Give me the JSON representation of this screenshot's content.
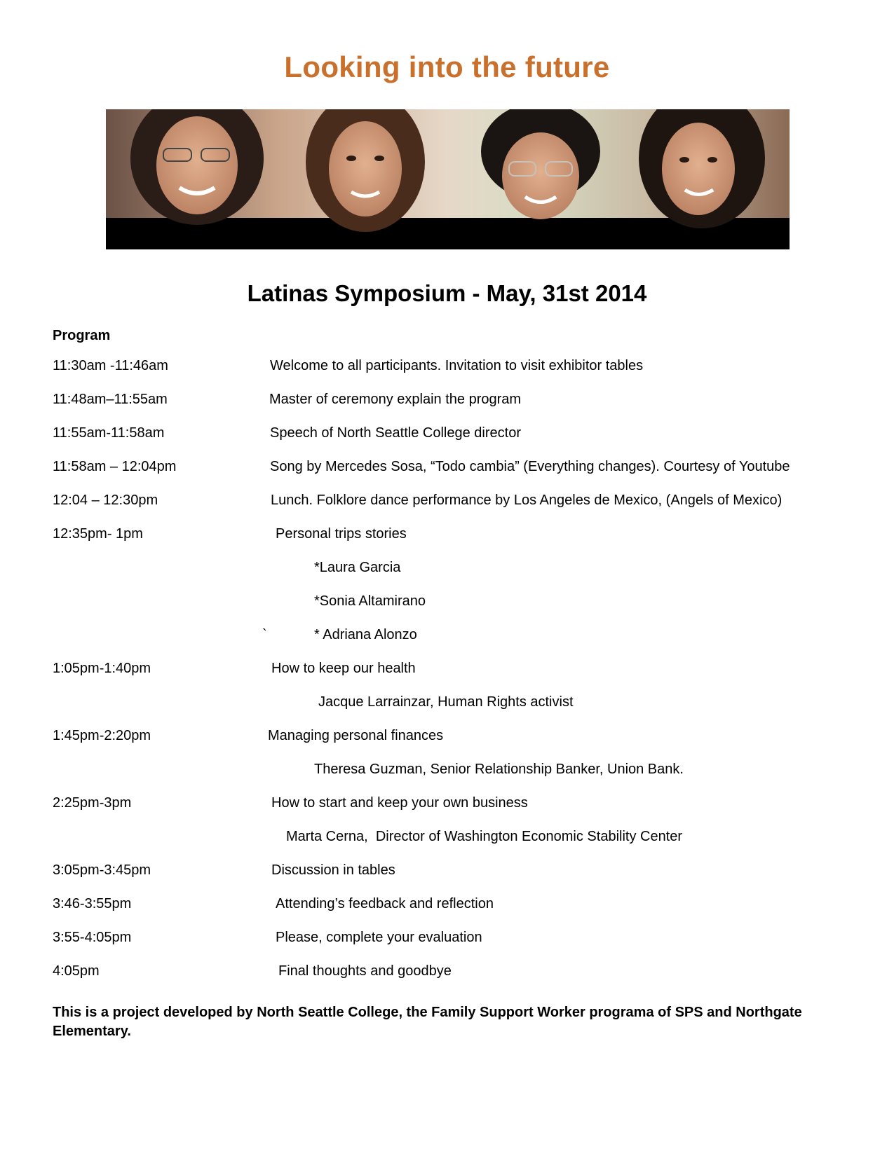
{
  "title": "Looking into the future",
  "subtitle": "Latinas Symposium - May, 31st 2014",
  "program_label": "Program",
  "schedule": [
    {
      "time": "11:30am -11:46am",
      "text": "Welcome to all participants. Invitation to visit exhibitor tables"
    },
    {
      "time": "11:48am–11:55am",
      "text": "Master of ceremony explain the program"
    },
    {
      "time": "11:55am-11:58am",
      "text": "Speech of North Seattle College director"
    },
    {
      "time": "11:58am – 12:04pm",
      "text": "Song by Mercedes Sosa, “Todo cambia” (Everything changes). Courtesy of Youtube"
    },
    {
      "time": "12:04 – 12:30pm",
      "text": "Lunch. Folklore dance performance by Los Angeles de Mexico, (Angels of Mexico)"
    },
    {
      "time": "12:35pm- 1pm",
      "text": "Personal trips stories"
    },
    {
      "time": "",
      "text": "*Laura Garcia"
    },
    {
      "time": "",
      "text": "*Sonia Altamirano"
    },
    {
      "time": "",
      "text": "* Adriana Alonzo",
      "mark": "`"
    },
    {
      "time": "1:05pm-1:40pm",
      "text": "How to keep our health"
    },
    {
      "time": "",
      "text": "Jacque Larrainzar, Human Rights activist"
    },
    {
      "time": "1:45pm-2:20pm",
      "text": "Managing personal finances"
    },
    {
      "time": "",
      "text": "Theresa Guzman, Senior Relationship Banker, Union Bank."
    },
    {
      "time": "2:25pm-3pm",
      "text": "How to start and keep your own business"
    },
    {
      "time": "",
      "text": "Marta Cerna,  Director of Washington Economic Stability Center"
    },
    {
      "time": "3:05pm-3:45pm",
      "text": "Discussion in tables"
    },
    {
      "time": "3:46-3:55pm",
      "text": "Attending’s feedback and reflection"
    },
    {
      "time": "3:55-4:05pm",
      "text": "Please, complete your evaluation"
    },
    {
      "time": "4:05pm",
      "text": "Final thoughts and goodbye"
    }
  ],
  "footer": "This is a project developed by North Seattle College, the Family Support Worker programa of SPS and Northgate Elementary.",
  "colors": {
    "title": "#c8702c",
    "text": "#000000",
    "banner_band": "#000000"
  }
}
